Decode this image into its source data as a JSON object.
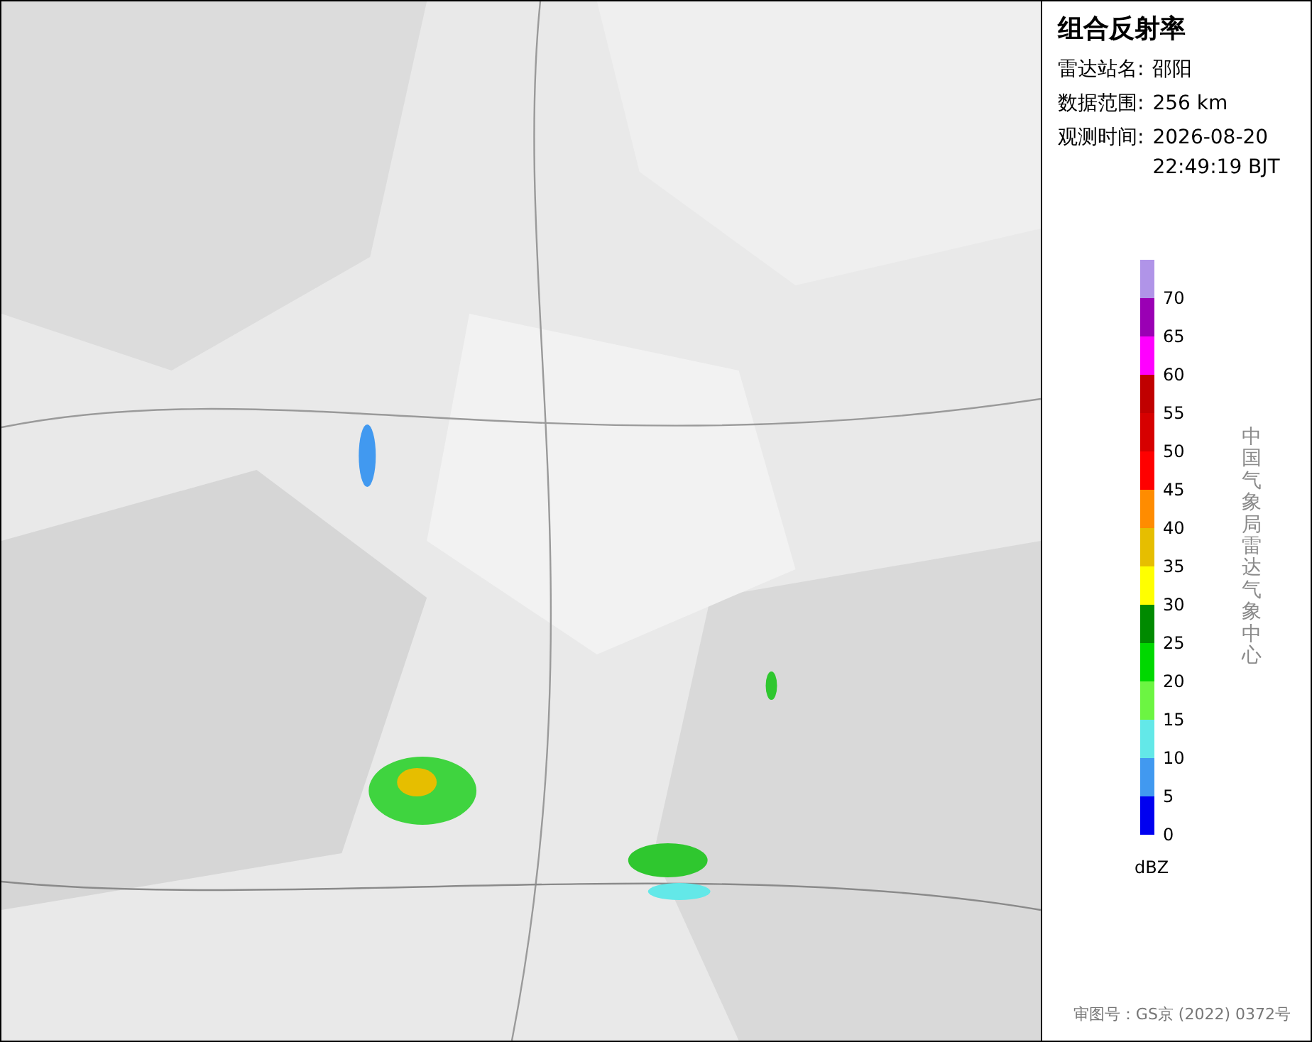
{
  "panel": {
    "title": "组合反射率",
    "fields": [
      {
        "label": "雷达站名:",
        "value": "邵阳"
      },
      {
        "label": "数据范围:",
        "value": "256 km"
      },
      {
        "label": "观测时间:",
        "value": "2026-08-20 22:49:19 BJT"
      }
    ],
    "legend": {
      "segments": [
        {
          "color": "#b094e8",
          "label": "70"
        },
        {
          "color": "#9a00b4",
          "label": "65"
        },
        {
          "color": "#ff00ff",
          "label": "60"
        },
        {
          "color": "#c00000",
          "label": "55"
        },
        {
          "color": "#d60000",
          "label": "50"
        },
        {
          "color": "#ff0000",
          "label": "45"
        },
        {
          "color": "#ff8c00",
          "label": "40"
        },
        {
          "color": "#e6be00",
          "label": "35"
        },
        {
          "color": "#ffff00",
          "label": "30"
        },
        {
          "color": "#008a00",
          "label": "25"
        },
        {
          "color": "#00d800",
          "label": "20"
        },
        {
          "color": "#6cf542",
          "label": "15"
        },
        {
          "color": "#63e8e8",
          "label": "10"
        },
        {
          "color": "#4199f0",
          "label": "5"
        },
        {
          "color": "#0000f0",
          "label": "0"
        }
      ],
      "unit": "dBZ"
    },
    "credit": "中国气象局雷达气象中心",
    "footer": "审图号：GS京 (2022) 0372号"
  }
}
